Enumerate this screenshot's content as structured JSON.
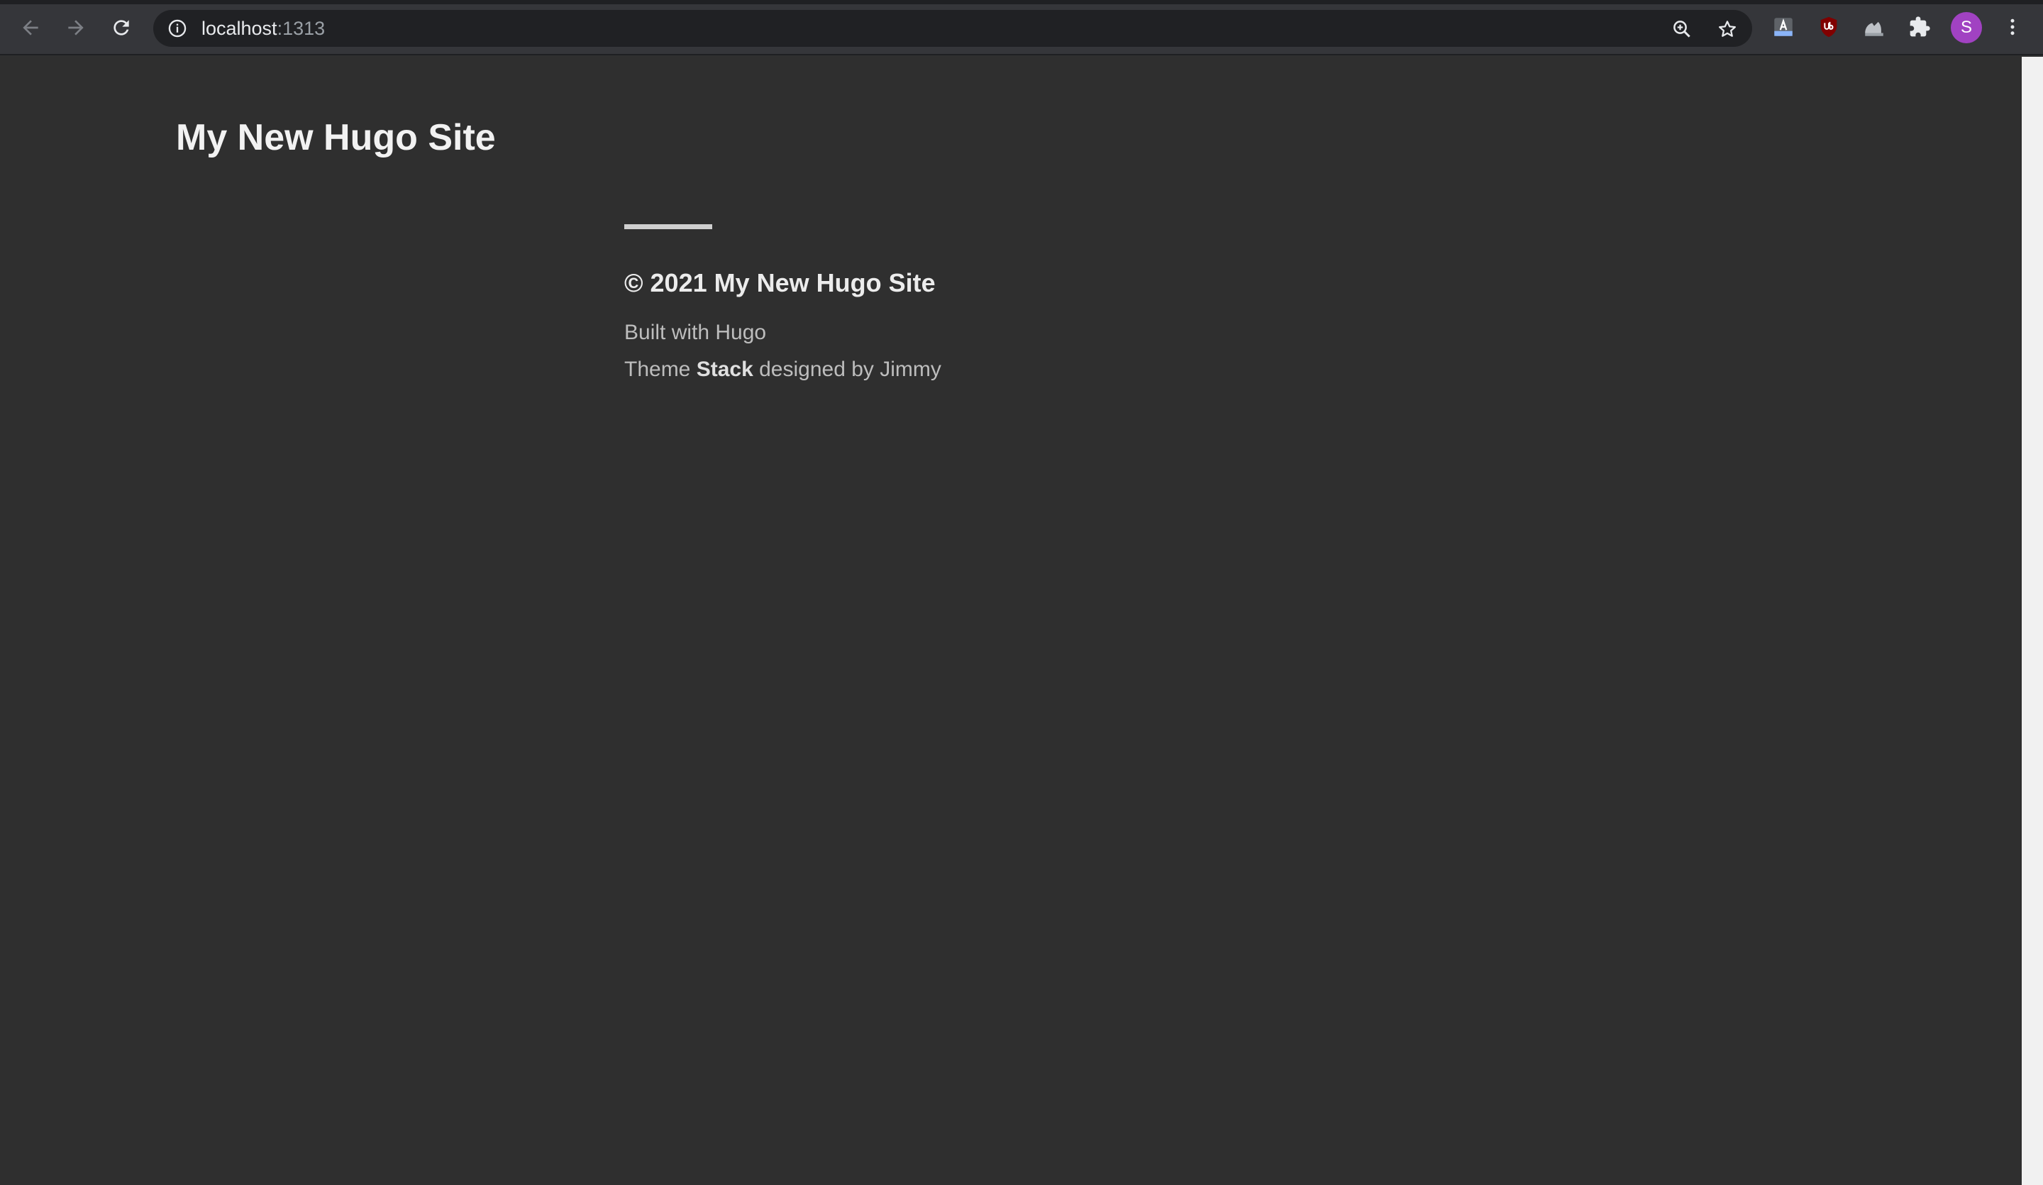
{
  "browser": {
    "url_host": "localhost",
    "url_port": ":1313",
    "icons": {
      "back": "arrow-left-icon",
      "forward": "arrow-right-icon",
      "reload": "reload-icon",
      "info": "info-icon",
      "zoom": "zoom-icon",
      "bookmark": "star-icon",
      "extensions": [
        "translate-extension-icon",
        "ublock-extension-icon",
        "extension-icon",
        "puzzle-icon"
      ],
      "menu": "more-vertical-icon"
    },
    "profile_initial": "S",
    "colors": {
      "toolbar": "#35363a",
      "omnibox": "#202124",
      "profile": "#a142c2",
      "ublock": "#800000"
    }
  },
  "site": {
    "title": "My New Hugo Site",
    "footer": {
      "copyright": "© 2021 My New Hugo Site",
      "built_with": "Built with Hugo",
      "theme_prefix": "Theme ",
      "theme_name": "Stack",
      "theme_suffix": " designed by Jimmy"
    },
    "colors": {
      "background": "#2f2f2f",
      "title": "#f2f2f2",
      "muted_text": "#bdbdbd"
    }
  }
}
